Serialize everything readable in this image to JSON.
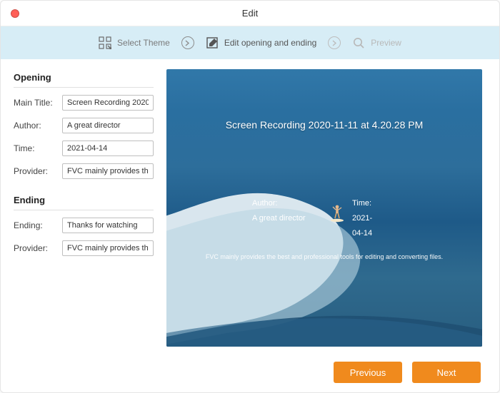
{
  "window": {
    "title": "Edit"
  },
  "steps": {
    "select_theme": "Select Theme",
    "edit_opening": "Edit opening and ending",
    "preview": "Preview"
  },
  "opening": {
    "heading": "Opening",
    "labels": {
      "main_title": "Main Title:",
      "author": "Author:",
      "time": "Time:",
      "provider": "Provider:"
    },
    "values": {
      "main_title": "Screen Recording 2020-11-11 at 4.20.28 PM",
      "author": "A great director",
      "time": "2021-04-14",
      "provider": "FVC mainly provides the best and professional tools for editing and converting files."
    }
  },
  "ending": {
    "heading": "Ending",
    "labels": {
      "ending": "Ending:",
      "provider": "Provider:"
    },
    "values": {
      "ending": "Thanks for watching",
      "provider": "FVC mainly provides the best and professional tools for editing and converting files."
    }
  },
  "preview_panel": {
    "title": "Screen Recording 2020-11-11 at 4.20.28 PM",
    "author_label": "Author:",
    "author_value": "A great director",
    "time_label": "Time:",
    "time_value": "2021-04-14",
    "provider": "FVC mainly provides the best and professional tools for editing and converting files."
  },
  "footer": {
    "previous": "Previous",
    "next": "Next"
  }
}
